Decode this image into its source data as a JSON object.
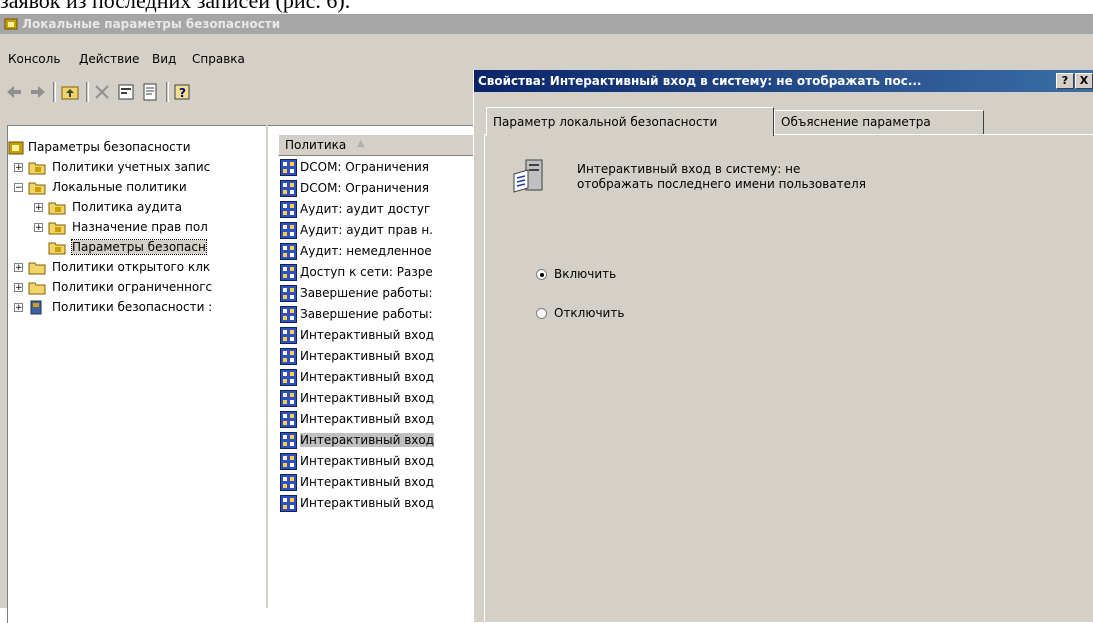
{
  "document": {
    "caption_fragment": "заявок из последних записей (рис. 6)."
  },
  "app": {
    "title": "Локальные параметры безопасности"
  },
  "menu": {
    "items": [
      "Консоль",
      "Действие",
      "Вид",
      "Справка"
    ]
  },
  "tree": {
    "root": "Параметры безопасности",
    "items": [
      {
        "label": "Политики учетных запис",
        "expanded": false
      },
      {
        "label": "Локальные политики",
        "expanded": true
      },
      {
        "label": "Политика аудита",
        "expanded": false
      },
      {
        "label": "Назначение прав пол",
        "expanded": false
      },
      {
        "label": "Параметры безопасн",
        "selected": true
      },
      {
        "label": "Политики открытого клк",
        "expanded": false
      },
      {
        "label": "Политики ограниченногс",
        "expanded": false
      },
      {
        "label": "Политики безопасности :",
        "expanded": false
      }
    ]
  },
  "list": {
    "column_header": "Политика",
    "rows": [
      "DCOM: Ограничения",
      "DCOM: Ограничения",
      "Аудит: аудит достуг",
      "Аудит: аудит прав н.",
      "Аудит: немедленное",
      "Доступ к сети: Разре",
      "Завершение работы:",
      "Завершение работы:",
      "Интерактивный вход",
      "Интерактивный вход",
      "Интерактивный вход",
      "Интерактивный вход",
      "Интерактивный вход",
      "Интерактивный вход",
      "Интерактивный вход",
      "Интерактивный вход",
      "Интерактивный вход"
    ]
  },
  "dialog": {
    "title": "Свойства: Интерактивный вход в систему: не отображать пос...",
    "help_label": "?",
    "close_label": "X",
    "tabs": [
      "Параметр локальной безопасности",
      "Объяснение параметра"
    ],
    "policy_name": "Интерактивный вход в систему: не отображать последнего имени пользователя",
    "options": [
      {
        "label": "Включить",
        "selected": true
      },
      {
        "label": "Отключить",
        "selected": false
      }
    ]
  },
  "colors": {
    "dialog_title_bar": "#0a246a",
    "window_face": "#d4d0c8"
  }
}
